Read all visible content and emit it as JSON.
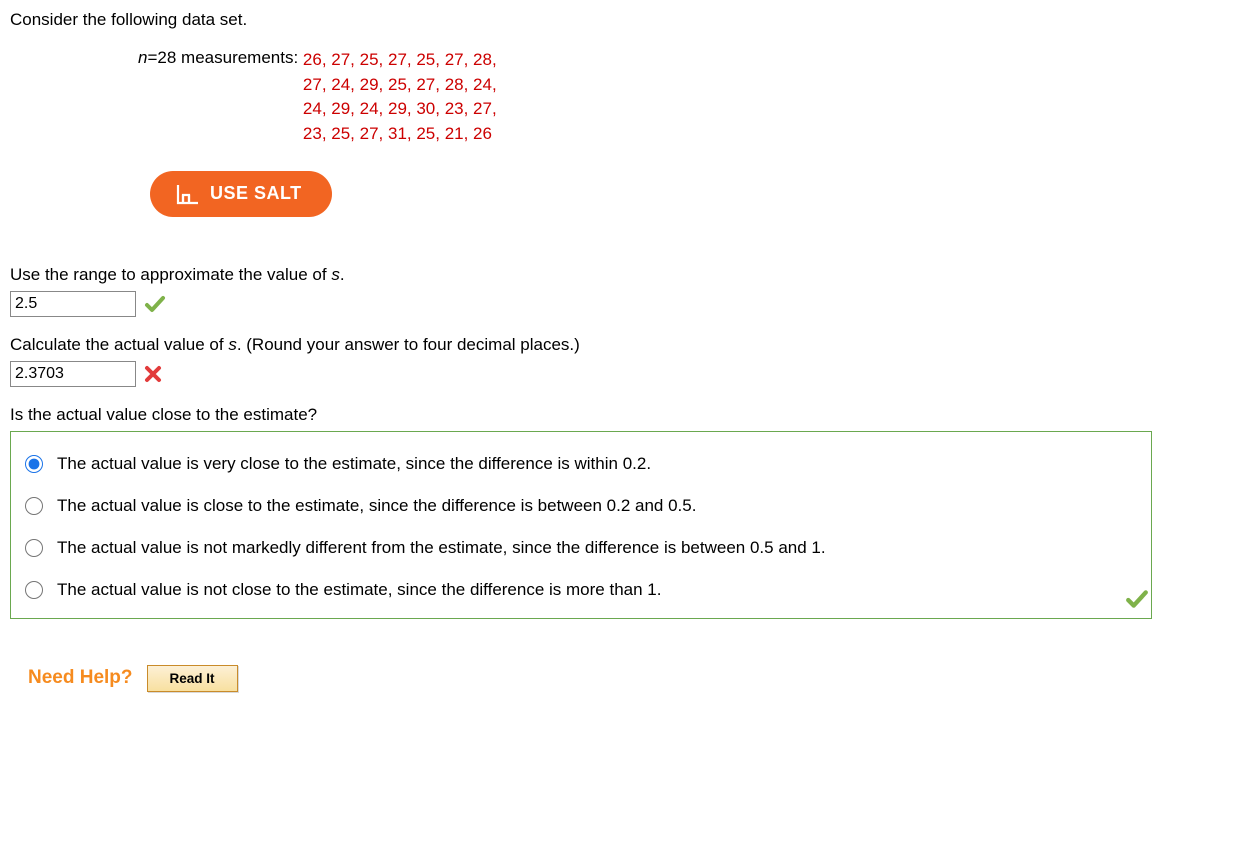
{
  "intro": "Consider the following data set.",
  "data": {
    "n_var": "n",
    "equals": " = ",
    "n_value": "28 measurements: ",
    "line1": "26, 27, 25, 27, 25, 27, 28,",
    "line2": "27, 24, 29, 25, 27, 28, 24,",
    "line3": "24, 29, 24, 29, 30, 23, 27,",
    "line4": "23, 25, 27, 31, 25, 21, 26"
  },
  "salt_label": "USE SALT",
  "q1": {
    "text_pre": "Use the range to approximate the value of ",
    "s": "s",
    "text_post": ".",
    "value": "2.5",
    "status": "correct"
  },
  "q2": {
    "text_pre": "Calculate the actual value of ",
    "s": "s",
    "text_post": ". (Round your answer to four decimal places.)",
    "value": "2.3703",
    "status": "incorrect"
  },
  "q3": {
    "prompt": "Is the actual value close to the estimate?",
    "options": [
      "The actual value is very close to the estimate, since the difference is within 0.2.",
      "The actual value is close to the estimate, since the difference is between 0.2 and 0.5.",
      "The actual value is not markedly different from the estimate, since the difference is between 0.5 and 1.",
      "The actual value is not close to the estimate, since the difference is more than 1."
    ],
    "selected_index": 0,
    "status": "correct"
  },
  "help": {
    "label": "Need Help?",
    "read_it": "Read It"
  }
}
